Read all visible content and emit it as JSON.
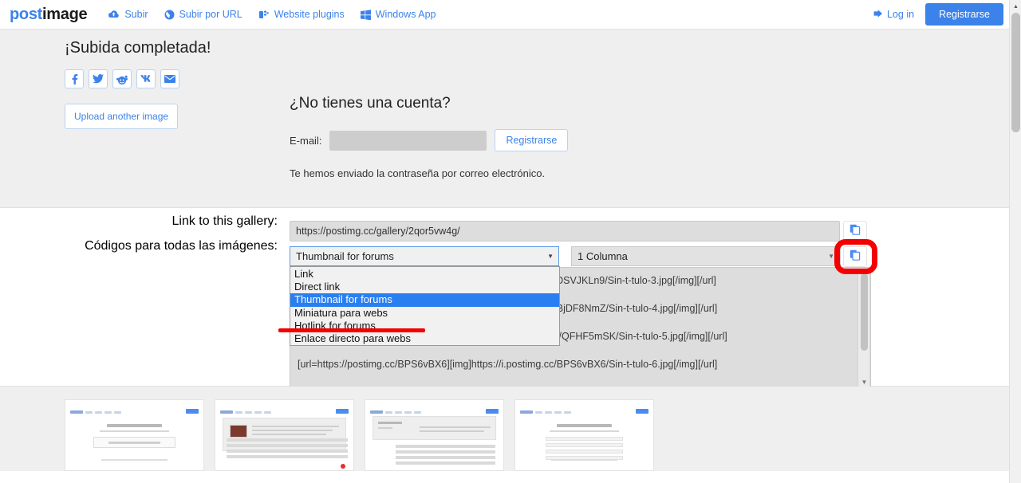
{
  "header": {
    "logo_post": "post",
    "logo_image": "image",
    "nav": [
      {
        "label": "Subir",
        "icon": "cloud-upload-icon"
      },
      {
        "label": "Subir por URL",
        "icon": "globe-icon"
      },
      {
        "label": "Website plugins",
        "icon": "plugin-icon"
      },
      {
        "label": "Windows App",
        "icon": "windows-icon"
      }
    ],
    "login_label": "Log in",
    "register_label": "Registrarse"
  },
  "upload": {
    "title": "¡Subida completada!",
    "share_buttons": [
      {
        "name": "facebook-share-button",
        "glyph": "f"
      },
      {
        "name": "twitter-share-button",
        "glyph": "twitter"
      },
      {
        "name": "reddit-share-button",
        "glyph": "reddit"
      },
      {
        "name": "vk-share-button",
        "glyph": "vk"
      },
      {
        "name": "email-share-button",
        "glyph": "envelope"
      }
    ],
    "upload_another_label": "Upload another image"
  },
  "account": {
    "title": "¿No tienes una cuenta?",
    "email_label": "E-mail:",
    "email_value": "",
    "email_placeholder": "",
    "signup_label": "Registrarse",
    "sent_note": "Te hemos enviado la contraseña por correo electrónico."
  },
  "codes": {
    "gallery_label": "Link to this gallery:",
    "gallery_url": "https://postimg.cc/gallery/2qor5vw4g/",
    "codes_label": "Códigos para todas las imágenes:",
    "selected_type": "Thumbnail for forums",
    "selected_columns": "1 Columna",
    "dropdown_options": [
      "Link",
      "Direct link",
      "Thumbnail for forums",
      "Miniatura para webs",
      "Hotlink for forums",
      "Enlace directo para webs"
    ],
    "dropdown_selected_index": 2,
    "code_lines": [
      "[url=https://postimg.cc/DSVJKLn9][img]https://i.postimg.cc/DSVJKLn9/Sin-t-tulo-3.jpg[/img][/url]",
      "[url=https://postimg.cc/BjDF8NmZ][img]https://i.postimg.cc/BjDF8NmZ/Sin-t-tulo-4.jpg[/img][/url]",
      "[url=https://postimg.cc/QFHF5mSK][img]https://i.postimg.cc/QFHF5mSK/Sin-t-tulo-5.jpg[/img][/url]",
      "[url=https://postimg.cc/BPS6vBX6][img]https://i.postimg.cc/BPS6vBX6/Sin-t-tulo-6.jpg[/img][/url]"
    ],
    "copy_icon": "copy-icon"
  },
  "annotations": {
    "circle_target": "copy-codes-button",
    "strike_target": "Enlace directo para webs",
    "color": "#f40000"
  },
  "thumbnails": [
    {
      "name": "gallery-thumbnail-1"
    },
    {
      "name": "gallery-thumbnail-2"
    },
    {
      "name": "gallery-thumbnail-3"
    },
    {
      "name": "gallery-thumbnail-4"
    }
  ],
  "colors": {
    "accent": "#3b82ea",
    "selection": "#2a7ff0",
    "annotation": "#f40000",
    "page_bg": "#efefef"
  }
}
